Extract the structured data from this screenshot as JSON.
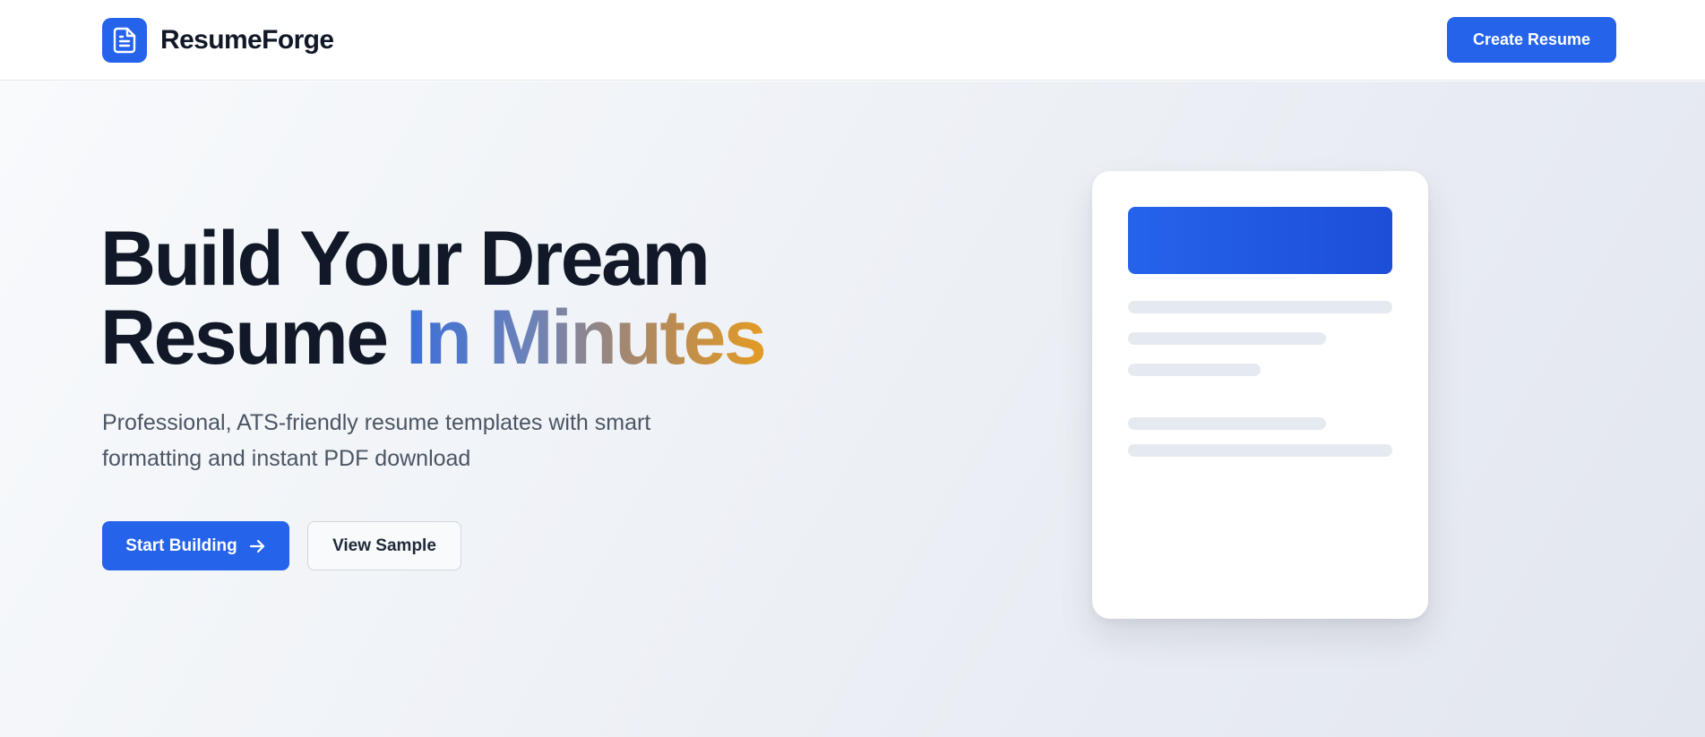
{
  "header": {
    "brand_name": "ResumeForge",
    "logo_icon": "document-icon",
    "cta_label": "Create Resume"
  },
  "hero": {
    "title_line1": "Build Your Dream",
    "title_line2_plain": "Resume",
    "title_line2_accent": "In Minutes",
    "subtitle_line1": "Professional, ATS-friendly resume templates with smart",
    "subtitle_line2": "formatting and instant PDF download",
    "primary_button": "Start Building",
    "primary_button_icon": "arrow-right-icon",
    "secondary_button": "View Sample"
  },
  "colors": {
    "primary": "#2563eb",
    "heading": "#111827",
    "body_text": "#4b5563",
    "accent_gradient_start": "#3b6fd8",
    "accent_gradient_end": "#e39b24"
  }
}
